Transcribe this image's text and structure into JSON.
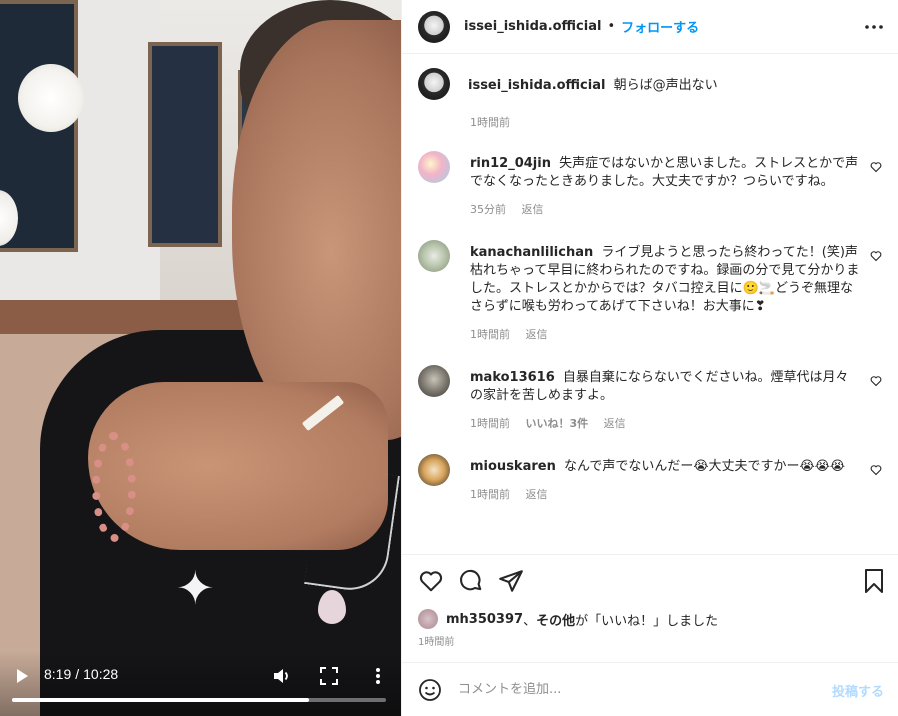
{
  "video": {
    "current_time": "8:19",
    "separator": "/",
    "duration": "10:28",
    "progress_fraction": 0.794
  },
  "header": {
    "username": "issei_ishida.official",
    "dot": "•",
    "follow_label": "フォローする"
  },
  "caption": {
    "username": "issei_ishida.official",
    "text": "朝らば@声出ない",
    "time": "1時間前"
  },
  "comments": [
    {
      "username": "rin12_04jin",
      "text": "失声症ではないかと思いました。ストレスとかで声でなくなったときありました。大丈夫ですか？つらいですね。",
      "time": "35分前",
      "likes": "",
      "reply": "返信"
    },
    {
      "username": "kanachanlilichan",
      "text": "ライブ見ようと思ったら終わってた！(笑)声枯れちゃって早目に終わられたのですね。録画の分で見て分かりました。ストレスとかからでは？タバコ控え目に🙂🚬どうぞ無理なさらずに喉も労わってあげて下さいね！お大事に❣",
      "time": "1時間前",
      "likes": "",
      "reply": "返信"
    },
    {
      "username": "mako13616",
      "text": "自暴自棄にならないでくださいね。煙草代は月々の家計を苦しめますよ。",
      "time": "1時間前",
      "likes": "いいね！3件",
      "reply": "返信"
    },
    {
      "username": "miouskaren",
      "text": "なんで声でないんだー😭大丈夫ですかー😭😭😭",
      "time": "1時間前",
      "likes": "",
      "reply": "返信"
    }
  ],
  "likes_line": {
    "user": "mh350397",
    "comma": "、",
    "others": "その他",
    "suffix": "が「いいね！」しました"
  },
  "post_time": "1時間前",
  "composer": {
    "placeholder": "コメントを追加...",
    "post_label": "投稿する"
  },
  "colors": {
    "accent": "#0095f6",
    "post_disabled": "#b3dbff",
    "muted": "#8e8e8e",
    "text": "#262626"
  }
}
